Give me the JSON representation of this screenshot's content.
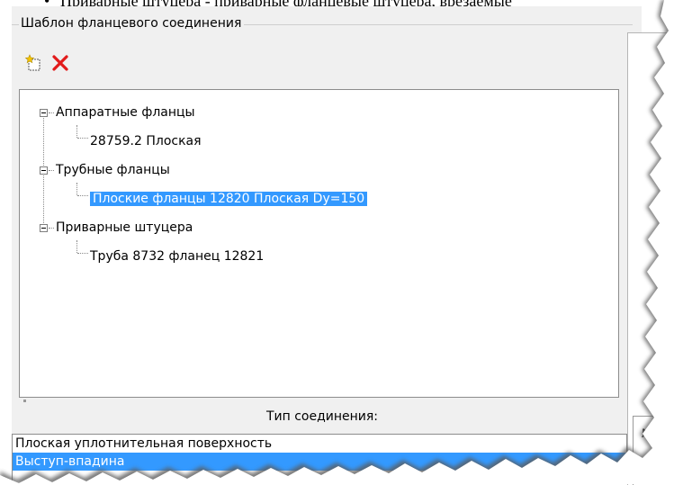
{
  "document": {
    "bullet": "•",
    "line_text": "Приварные штуцера - приварные фланцевые штуцера, врезаемые"
  },
  "dialog": {
    "group_title": "Шаблон фланцевого соединения",
    "toolbar": {
      "add_icon": "new-item-icon",
      "delete_icon": "delete-x-icon",
      "delete_color": "#e21b1b"
    },
    "tree": {
      "groups": [
        {
          "label": "Аппаратные фланцы",
          "children": [
            "28759.2 Плоская"
          ]
        },
        {
          "label": "Трубные фланцы",
          "children": [
            "Плоские фланцы 12820 Плоская Dy=150"
          ]
        },
        {
          "label": "Приварные штуцера",
          "children": [
            "Труба 8732 фланец 12821"
          ]
        }
      ],
      "selected": "Плоские фланцы 12820 Плоская Dy=150",
      "selection_color": "#3399ff"
    },
    "type_label": "Тип соединения:",
    "type_list": {
      "items": [
        "Плоская уплотнительная поверхность",
        "Выступ-впадина"
      ],
      "selected": "Выступ-впадина"
    },
    "right_box_text": "№"
  }
}
